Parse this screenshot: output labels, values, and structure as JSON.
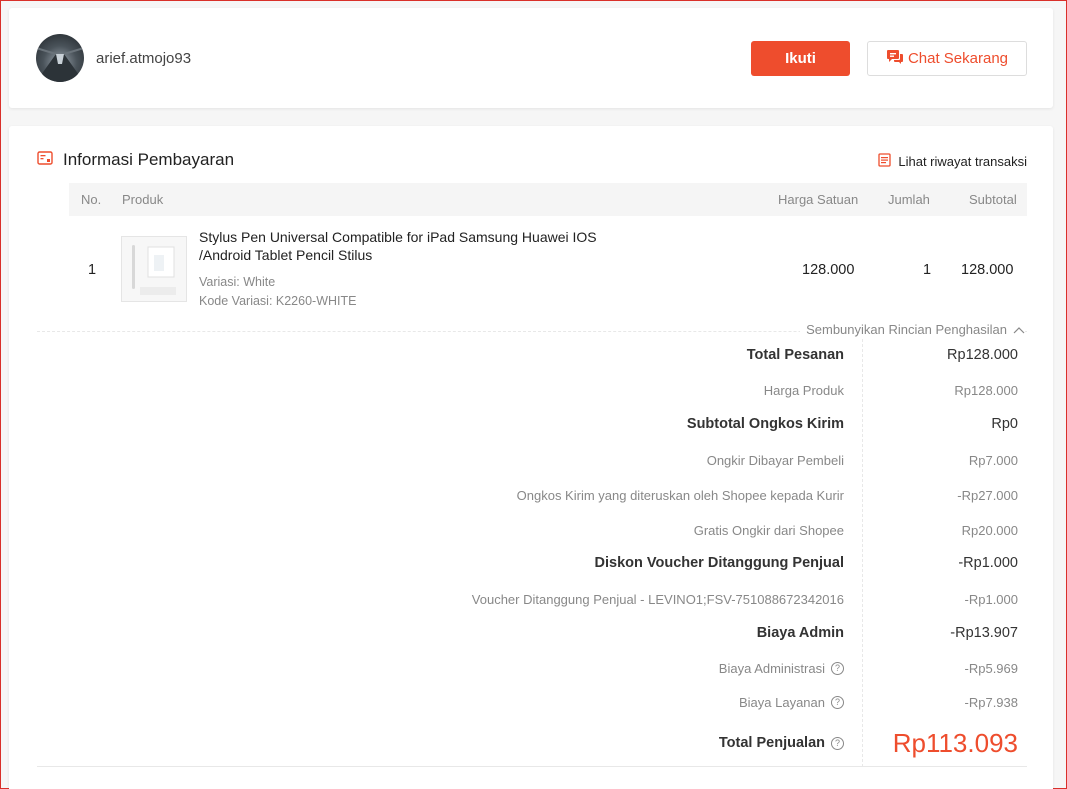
{
  "seller": {
    "username": "arief.atmojo93",
    "follow_label": "Ikuti",
    "chat_label": "Chat Sekarang"
  },
  "payment": {
    "title": "Informasi Pembayaran",
    "history_link": "Lihat riwayat transaksi",
    "columns": [
      "No.",
      "Produk",
      "Harga Satuan",
      "Jumlah",
      "Subtotal"
    ],
    "product": {
      "no": "1",
      "name": "Stylus Pen Universal Compatible for iPad Samsung Huawei IOS /Android Tablet Pencil Stilus",
      "variation": "Variasi: White",
      "variation_code": "Kode Variasi: K2260-WHITE",
      "unit_price": "128.000",
      "quantity": "1",
      "subtotal": "128.000"
    },
    "hide_details_label": "Sembunyikan Rincian Penghasilan",
    "breakdown": [
      {
        "label": "Total Pesanan",
        "value": "Rp128.000",
        "kind": "main"
      },
      {
        "label": "Harga Produk",
        "value": "Rp128.000",
        "kind": "sub"
      },
      {
        "label": "Subtotal Ongkos Kirim",
        "value": "Rp0",
        "kind": "main"
      },
      {
        "label": "Ongkir Dibayar Pembeli",
        "value": "Rp7.000",
        "kind": "sub"
      },
      {
        "label": "Ongkos Kirim yang diteruskan oleh Shopee kepada Kurir",
        "value": "-Rp27.000",
        "kind": "sub"
      },
      {
        "label": "Gratis Ongkir dari Shopee",
        "value": "Rp20.000",
        "kind": "sub"
      },
      {
        "label": "Diskon Voucher Ditanggung Penjual",
        "value": "-Rp1.000",
        "kind": "main"
      },
      {
        "label": "Voucher Ditanggung Penjual - LEVINO1;FSV-751088672342016",
        "value": "-Rp1.000",
        "kind": "sub"
      },
      {
        "label": "Biaya Admin",
        "value": "-Rp13.907",
        "kind": "main"
      },
      {
        "label": "Biaya Administrasi",
        "value": "-Rp5.969",
        "kind": "sub"
      },
      {
        "label": "Biaya Layanan",
        "value": "-Rp7.938",
        "kind": "sub"
      },
      {
        "label": "Total Penjualan",
        "value": "Rp113.093",
        "kind": "total"
      }
    ]
  },
  "colors": {
    "accent": "#ee4d2d"
  },
  "icons": {
    "chat": "chat-bubble-icon",
    "payment": "payment-icon",
    "history": "receipt-icon",
    "collapse": "chevron-up-icon",
    "help": "question-circle-icon"
  }
}
